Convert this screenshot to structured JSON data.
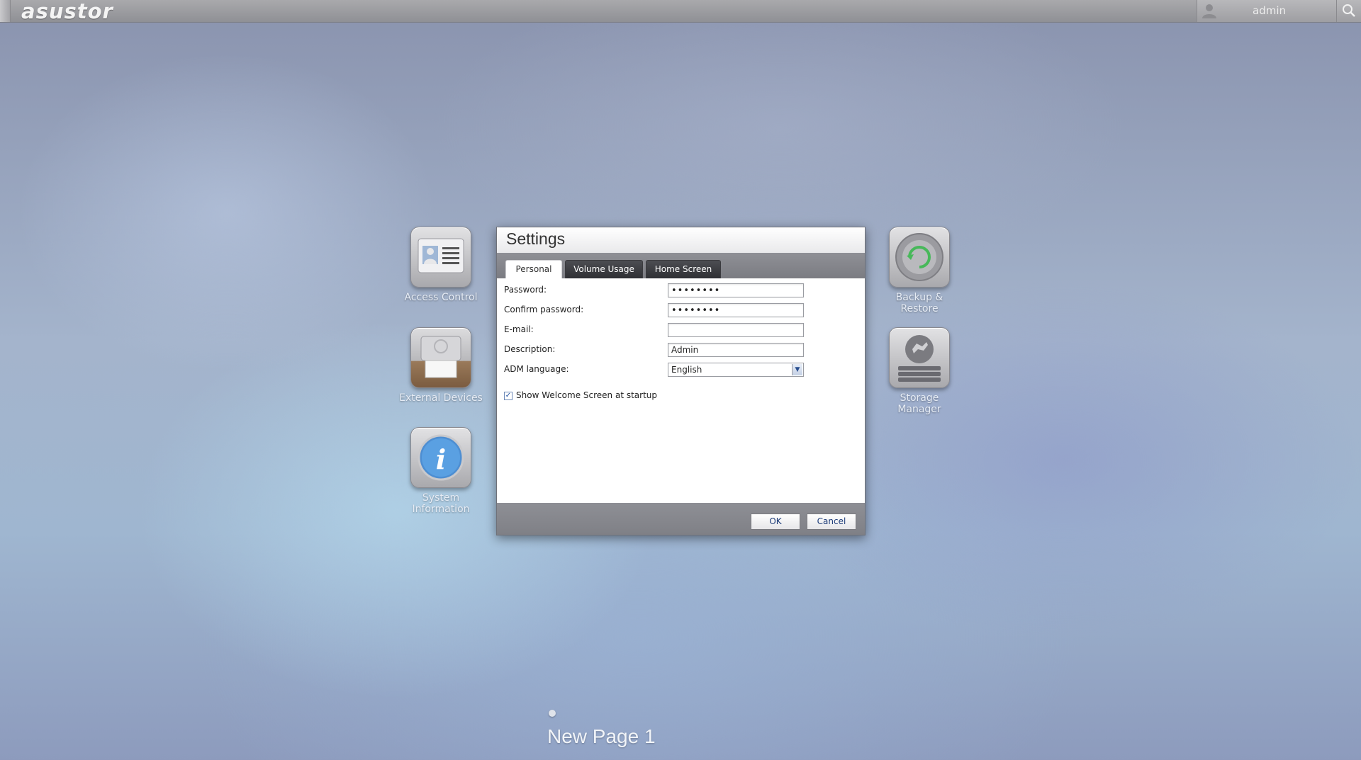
{
  "topbar": {
    "logo": "asustor",
    "username": "admin"
  },
  "desktop": {
    "apps_left": [
      {
        "label_lines": [
          "Access Control"
        ],
        "icon": "id-card-icon"
      },
      {
        "label_lines": [
          "External Devices"
        ],
        "icon": "printer-icon"
      },
      {
        "label_lines": [
          "System",
          "Information"
        ],
        "icon": "info-icon"
      }
    ],
    "apps_right": [
      {
        "label_lines": [
          "Backup &",
          "Restore"
        ],
        "icon": "backup-icon"
      },
      {
        "label_lines": [
          "Storage",
          "Manager"
        ],
        "icon": "storage-icon"
      }
    ],
    "page_name": "New Page 1"
  },
  "dialog": {
    "title": "Settings",
    "tabs": [
      {
        "label": "Personal",
        "active": true
      },
      {
        "label": "Volume Usage",
        "active": false
      },
      {
        "label": "Home Screen",
        "active": false
      }
    ],
    "fields": {
      "password": {
        "label": "Password:",
        "value": "••••••••"
      },
      "confirm": {
        "label": "Confirm password:",
        "value": "••••••••"
      },
      "email": {
        "label": "E-mail:",
        "value": ""
      },
      "description": {
        "label": "Description:",
        "value": "Admin"
      },
      "language": {
        "label": "ADM language:",
        "value": "English"
      }
    },
    "welcome_checkbox": {
      "label": "Show Welcome Screen at startup",
      "checked": true
    },
    "ok_label": "OK",
    "cancel_label": "Cancel"
  }
}
